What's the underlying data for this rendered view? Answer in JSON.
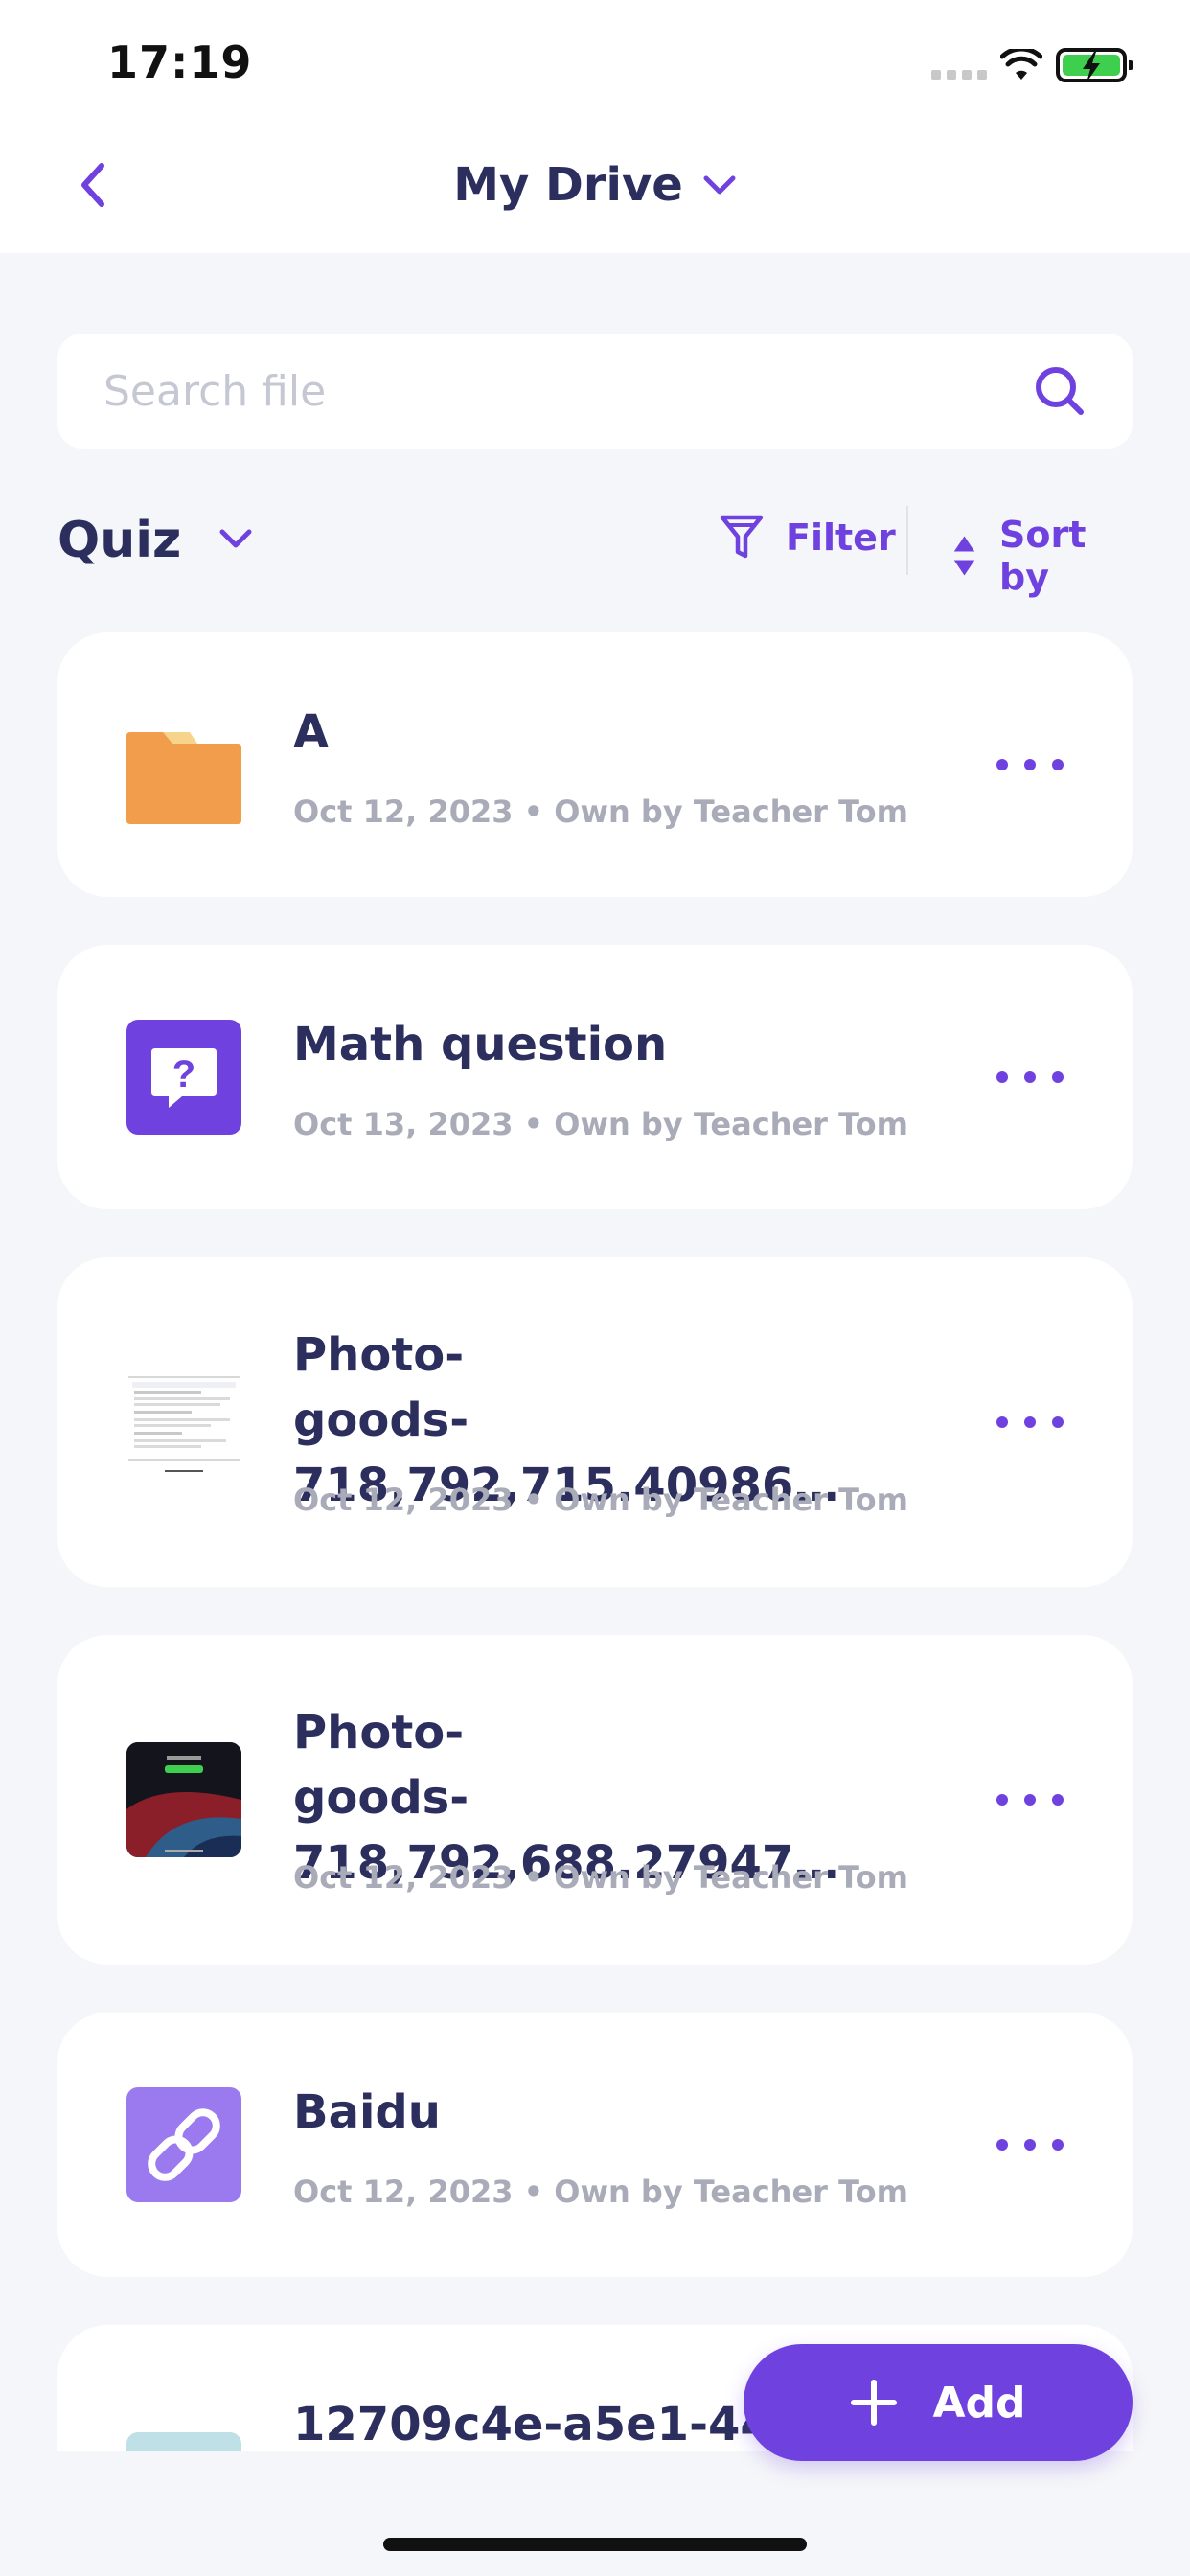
{
  "status_bar": {
    "time": "17:19"
  },
  "header": {
    "title": "My Drive",
    "back_icon": "chevron-left-icon",
    "title_icon": "chevron-down-icon"
  },
  "search": {
    "placeholder": "Search file",
    "value": "",
    "icon": "search-icon"
  },
  "section": {
    "title": "Quiz",
    "filter_label": "Filter",
    "sort_label": "Sort by"
  },
  "files": [
    {
      "name": "A",
      "date": "Oct 12, 2023",
      "owner": "Own by Teacher Tom",
      "type": "folder"
    },
    {
      "name": "Math question",
      "date": "Oct 13, 2023",
      "owner": "Own by Teacher Tom",
      "type": "question"
    },
    {
      "name_line1": "Photo-",
      "name_line2": "goods-718,792,715.40986…",
      "date": "Oct 12, 2023",
      "owner": "Own by Teacher Tom",
      "type": "photo-document"
    },
    {
      "name_line1": "Photo-",
      "name_line2": "goods-718,792,688.27947…",
      "date": "Oct 12, 2023",
      "owner": "Own by Teacher Tom",
      "type": "photo-wallpaper"
    },
    {
      "name": "Baidu",
      "date": "Oct 12, 2023",
      "owner": "Own by Teacher Tom",
      "type": "link"
    },
    {
      "name": "12709c4e-a5e1-443",
      "type": "image"
    }
  ],
  "separator": "•",
  "add_button": {
    "label": "Add"
  },
  "colors": {
    "accent": "#6f42e0",
    "title": "#2c2f5e",
    "meta": "#a9acb8",
    "folder": "#f29d4c",
    "link_bg": "#9b79ef"
  }
}
